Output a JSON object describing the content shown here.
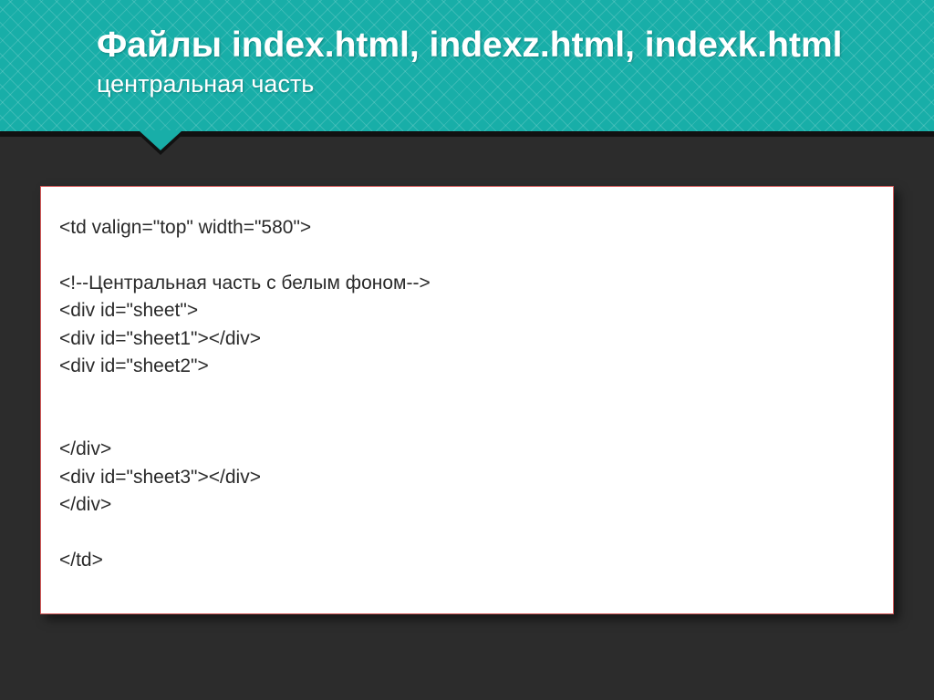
{
  "header": {
    "title": "Файлы index.html, indexz.html, indexk.html",
    "subtitle": "центральная часть"
  },
  "code": {
    "lines": [
      "<td valign=\"top\" width=\"580\">",
      "",
      "<!--Центральная часть с белым фоном-->",
      "<div id=\"sheet\">",
      "<div id=\"sheet1\"></div>",
      "<div id=\"sheet2\">",
      "",
      "",
      "</div>",
      "<div id=\"sheet3\"></div>",
      "</div>",
      "",
      "</td>"
    ]
  }
}
